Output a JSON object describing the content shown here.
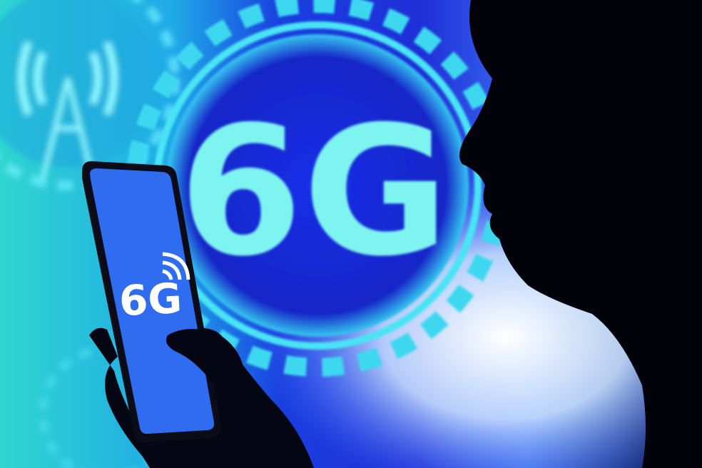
{
  "background": {
    "big_label": "6G",
    "colors": {
      "cyan": "#3fe0e0",
      "blue": "#1a2fd8",
      "deep_blue": "#0a1a9a",
      "glow": "#e8f4ff",
      "silhouette": "#02030a"
    }
  },
  "phone": {
    "screen_label": "6G",
    "screen_color": "#2f6cf0",
    "icon": "wifi-signal-icon"
  }
}
